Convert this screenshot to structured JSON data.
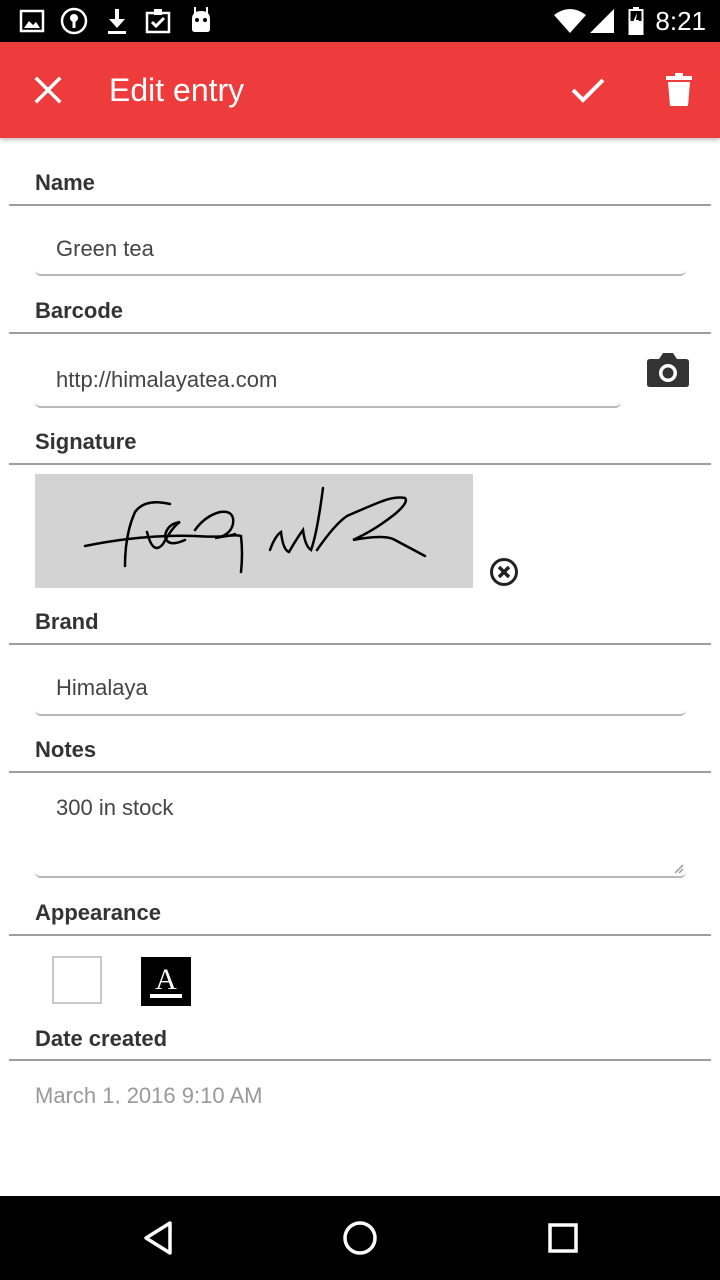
{
  "status_bar": {
    "time": "8:21",
    "icons": [
      "gallery-icon",
      "vpn-key-icon",
      "download-icon",
      "clipboard-check-icon",
      "android-icon",
      "wifi-icon",
      "signal-icon",
      "battery-icon"
    ]
  },
  "app_bar": {
    "title": "Edit entry",
    "background": "#ee3b3b",
    "actions": [
      "close-icon",
      "check-icon",
      "trash-icon"
    ]
  },
  "form": {
    "name": {
      "label": "Name",
      "value": "Green tea"
    },
    "barcode": {
      "label": "Barcode",
      "value": "http://himalayatea.com"
    },
    "signature": {
      "label": "Signature"
    },
    "brand": {
      "label": "Brand",
      "value": "Himalaya"
    },
    "notes": {
      "label": "Notes",
      "value": "300 in stock"
    },
    "appearance": {
      "label": "Appearance",
      "background_color": "#ffffff",
      "foreground_color": "#000000",
      "foreground_glyph": "A"
    },
    "date_created": {
      "label": "Date created",
      "value": "March 1, 2016 9:10 AM"
    }
  },
  "nav_bar": {
    "buttons": [
      "back-icon",
      "home-icon",
      "recents-icon"
    ]
  }
}
